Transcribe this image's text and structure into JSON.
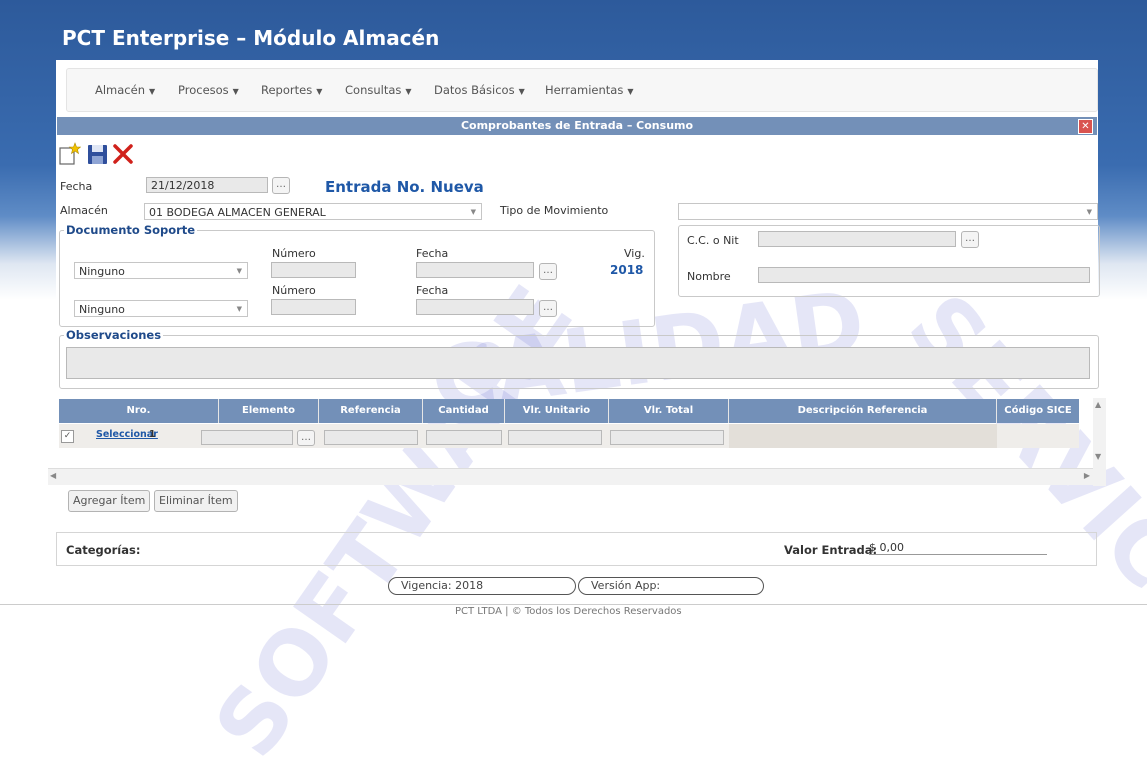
{
  "app": {
    "title": "PCT Enterprise – Módulo Almacén"
  },
  "nav": {
    "items": [
      {
        "label": "Almacén"
      },
      {
        "label": "Procesos"
      },
      {
        "label": "Reportes"
      },
      {
        "label": "Consultas"
      },
      {
        "label": "Datos Básicos"
      },
      {
        "label": "Herramientas"
      }
    ]
  },
  "window": {
    "title": "Comprobantes de Entrada – Consumo",
    "close_glyph": "✕"
  },
  "toolbar": {
    "icons": [
      "new-document-icon",
      "save-icon",
      "delete-icon"
    ]
  },
  "form": {
    "fecha_label": "Fecha",
    "fecha_value": "21/12/2018",
    "entrada_title": "Entrada No. Nueva",
    "almacen_label": "Almacén",
    "almacen_value": "01 BODEGA ALMACEN GENERAL",
    "tipo_mov_label": "Tipo de Movimiento",
    "tipo_mov_value": "",
    "doc_soporte": {
      "legend": "Documento Soporte",
      "numero_label": "Número",
      "fecha_label": "Fecha",
      "vig_label": "Vig.",
      "vig_value": "2018",
      "doc1_value": "Ninguno",
      "doc2_value": "Ninguno"
    },
    "cc_nit_label": "C.C. o Nit",
    "nombre_label": "Nombre",
    "observaciones_legend": "Observaciones"
  },
  "grid": {
    "columns": [
      "Nro.",
      "Elemento",
      "Referencia",
      "Cantidad",
      "Vlr. Unitario",
      "Vlr. Total",
      "Descripción Referencia",
      "Código SICE"
    ],
    "row": {
      "checked": true,
      "select_link": "Seleccionar",
      "nro": "1"
    }
  },
  "buttons": {
    "add_item": "Agregar Ítem",
    "remove_item": "Eliminar Ítem"
  },
  "summary": {
    "categorias_label": "Categorías:",
    "valor_entrada_label": "Valor Entrada:",
    "valor_entrada_value": "$ 0,00"
  },
  "footer": {
    "vigencia": "Vigencia: 2018",
    "version": "Versión App:",
    "copyright": "PCT LTDA |  © Todos los Derechos Reservados"
  },
  "colors": {
    "header_blue": "#2d5a9b",
    "grid_header": "#7390b8",
    "accent_text": "#1f58a7"
  }
}
